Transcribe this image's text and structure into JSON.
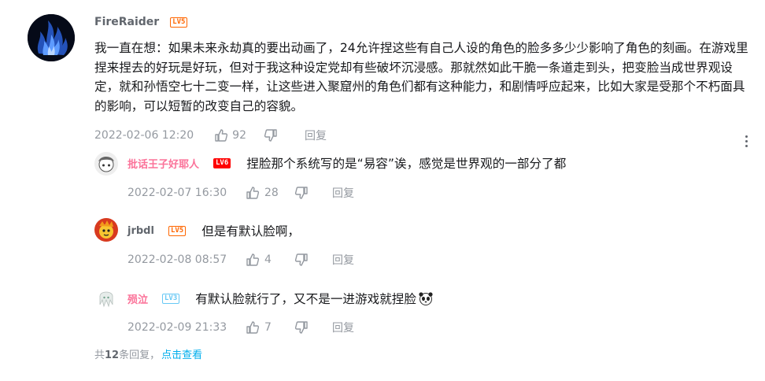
{
  "colors": {
    "level5": "#ff6600",
    "level5_sub": "#ff0000",
    "level3": "#67c8f5",
    "link": "#00aeec",
    "meta": "#9499a0",
    "vip_name": "#fb7299"
  },
  "main": {
    "username": "FireRaider",
    "level": "LV5",
    "text": "我一直在想：如果未来永劫真的要出动画了，24允许捏这些有自己人设的角色的脸多多少少影响了角色的刻画。在游戏里捏来捏去的好玩是好玩，但对于我这种设定党却有些破坏沉浸感。那就然如此干脆一条道走到头，把变脸当成世界观设定，就和孙悟空七十二变一样，让这些进入聚窟州的角色们都有这种能力，和剧情呼应起来，比如大家是受那个不朽面具的影响，可以短暂的改变自己的容貌。",
    "time": "2022-02-06 12:20",
    "likes": "92",
    "reply_label": "回复",
    "more_icon": "more-vertical-icon"
  },
  "replies": [
    {
      "username": "批话王子好耶人",
      "level": "LV6",
      "text": "捏脸那个系统写的是“易容”诶，感觉是世界观的一部分了都",
      "time": "2022-02-07 16:30",
      "likes": "28",
      "reply_label": "回复"
    },
    {
      "username": "jrbdl",
      "level": "LV5",
      "text": "但是有默认脸啊，",
      "time": "2022-02-08 08:57",
      "likes": "4",
      "reply_label": "回复"
    },
    {
      "username": "殒泣",
      "level": "LV3",
      "text": "有默认脸就行了，又不是一进游戏就捏脸",
      "time": "2022-02-09 21:33",
      "likes": "7",
      "reply_label": "回复"
    }
  ],
  "summary": {
    "prefix": "共",
    "count": "12",
    "suffix": "条回复，",
    "link": "点击查看"
  }
}
